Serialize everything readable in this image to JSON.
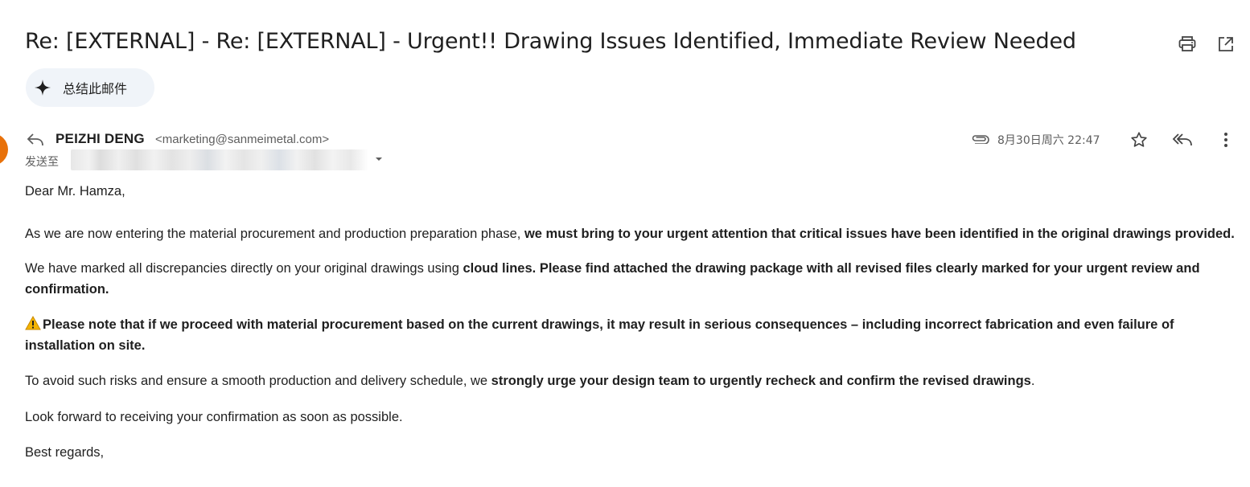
{
  "email": {
    "subject": "Re: [EXTERNAL] - Re: [EXTERNAL] - Urgent!! Drawing Issues Identified, Immediate Review Needed",
    "summarize_label": "总结此邮件",
    "sender": {
      "name": "PEIZHI DENG",
      "email": "<marketing@sanmeimetal.com>"
    },
    "to_label": "发送至",
    "date": "8月30日周六 22:47",
    "body": {
      "greeting": "Dear Mr. Hamza,",
      "p1_normal": "As we are now entering the material procurement and production preparation phase, ",
      "p1_bold": "we must bring to your urgent attention that critical issues have been identified in the original drawings provided.",
      "p2_normal": "We have marked all discrepancies directly on your original drawings using ",
      "p2_bold": "cloud lines. Please find attached the drawing package with all revised files clearly marked for your urgent review and confirmation.",
      "p3_icon": "⚠️",
      "p3_bold": "Please note that if we proceed with material procurement based on the current drawings, it may result in serious consequences – including incorrect fabrication and even failure of installation on site.",
      "p4_normal": "To avoid such risks and ensure a smooth production and delivery schedule, we ",
      "p4_bold": "strongly urge your design team to urgently recheck and confirm the revised drawings",
      "p4_end": ".",
      "p5": "Look forward to receiving your confirmation as soon as possible.",
      "p6": "Best regards,"
    }
  },
  "icons": {
    "print": "print-icon",
    "popout": "open-in-new-window-icon",
    "sparkle": "sparkle-icon",
    "reply_arrow": "reply-arrow-icon",
    "recipients_caret": "dropdown-caret-icon",
    "attachment": "paperclip-icon",
    "star": "star-icon",
    "reply_all": "reply-all-icon",
    "more": "more-vert-icon"
  },
  "colors": {
    "avatar": "#e8710a",
    "summarize_bg": "#f0f4f9",
    "muted_text": "#5e5e5e"
  }
}
